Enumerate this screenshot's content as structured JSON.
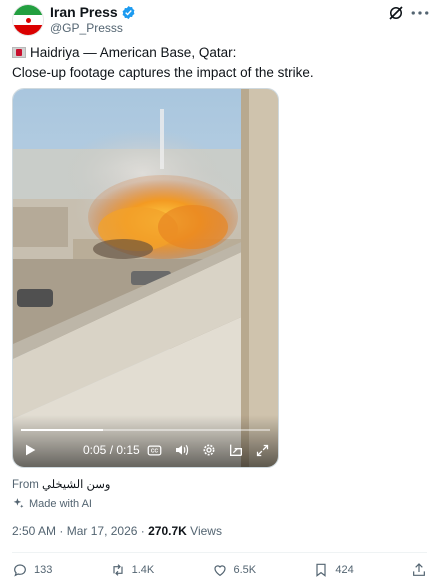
{
  "author": {
    "display_name": "Iran Press",
    "handle": "@GP_Presss",
    "verified": true,
    "avatar": "iran-flag"
  },
  "header_icons": [
    "grok-icon",
    "more-icon"
  ],
  "tweet": {
    "line1": "Haidriya — American Base, Qatar:",
    "line2": "Close-up footage captures the impact of the strike.",
    "flag_emoji": "qatar-flag"
  },
  "video": {
    "time": "0:05 / 0:15",
    "progress": 0.33,
    "controls": [
      "play-icon",
      "captions-icon",
      "volume-icon",
      "settings-icon",
      "pip-icon",
      "fullscreen-icon"
    ]
  },
  "attribution": {
    "from_label": "From",
    "source_name": "وسن الشيخلي",
    "made_with_ai": "Made with AI"
  },
  "meta": {
    "time": "2:50 AM",
    "separator": "·",
    "date": "Mar 17, 2026",
    "views_count": "270.7K",
    "views_label": "Views"
  },
  "actions": {
    "replies": "133",
    "reposts": "1.4K",
    "likes": "6.5K",
    "bookmarks": "424"
  },
  "colors": {
    "text": "#0f1419",
    "secondary": "#536471",
    "verified": "#1d9bf0",
    "divider": "#eff3f4"
  }
}
